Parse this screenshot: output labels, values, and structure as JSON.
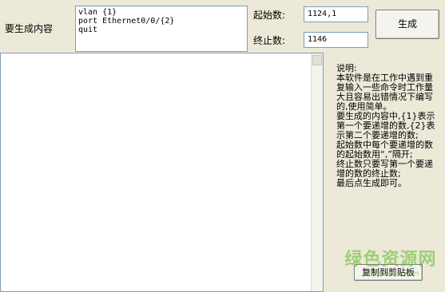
{
  "form": {
    "template_label": "要生成内容",
    "template_lines": [
      "vlan {1}",
      "port Ethernet0/0/{2}",
      "quit"
    ],
    "start_label": "起始数:",
    "start_value": "1124,1",
    "end_label": "终止数:",
    "end_value": "1146",
    "generate_label": "生成"
  },
  "output": {
    "value": ""
  },
  "instructions": {
    "lines": [
      "说明:",
      "本软件是在工作中遇到重复输入一些命令时工作量大且容易出错情况下编写的,使用简单。",
      "要生成的内容中,{1}表示第一个要递增的数,{2}表示第二个要递增的数;",
      "起始数中每个要递增的数的起始数用“,”隔开;",
      "终止数只要写第一个要递增的数的终止数;",
      "最后点生成即可。"
    ]
  },
  "copy_button": {
    "label": "复制到剪贴板"
  },
  "watermark": {
    "main": "绿色资源网",
    "sub": "www.downcc.com"
  }
}
